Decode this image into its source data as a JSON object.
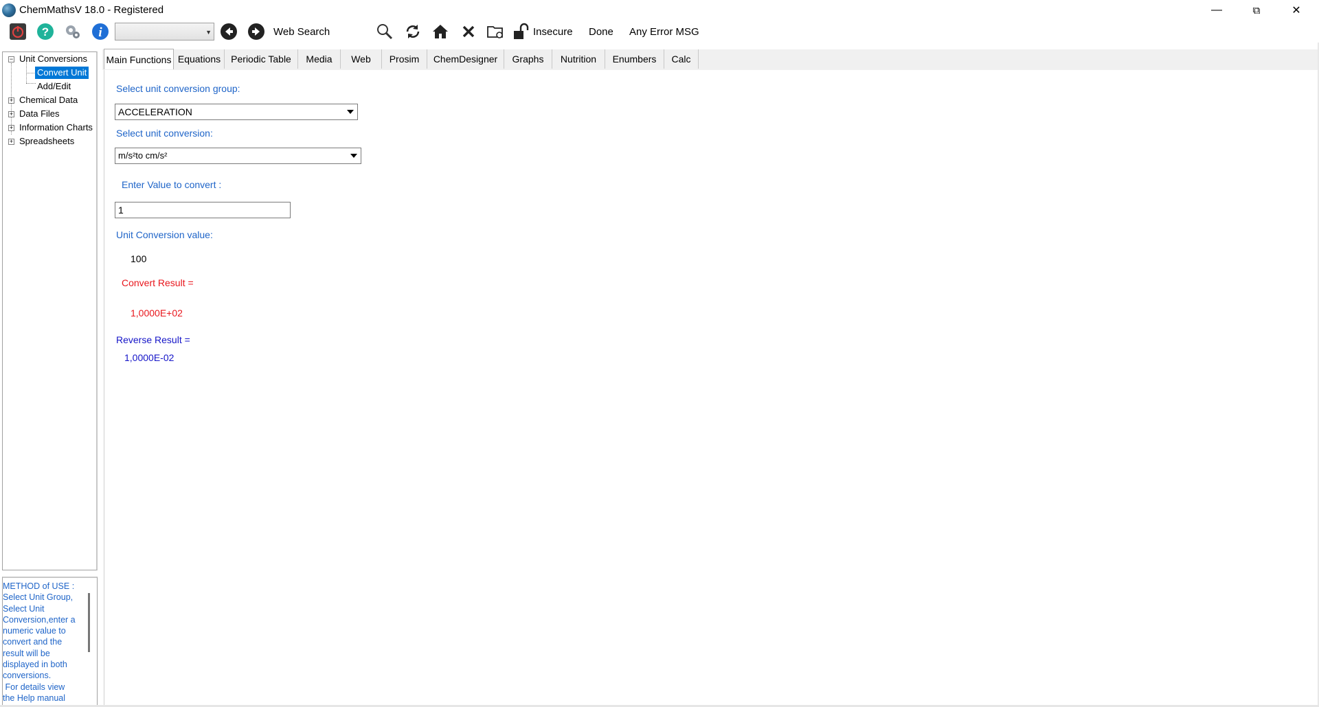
{
  "window": {
    "title": "ChemMathsV 18.0 - Registered",
    "minimize_glyph": "—",
    "maximize_glyph": "⧉",
    "close_glyph": "✕"
  },
  "toolbar": {
    "web_search_label": "Web Search",
    "insecure_label": "Insecure",
    "done_label": "Done",
    "error_label": "Any Error MSG",
    "combo_value": "",
    "icons": [
      "power-icon",
      "help-icon",
      "tools-icon",
      "info-icon",
      "back-arrow-icon",
      "forward-arrow-icon",
      "magnifier-icon",
      "refresh-icon",
      "home-icon",
      "stop-icon",
      "folder-icon",
      "unlock-icon"
    ]
  },
  "tree": {
    "unit_conversions": "Unit Conversions",
    "convert_unit": "Convert Unit",
    "add_edit": "Add/Edit",
    "chemical_data": "Chemical Data",
    "data_files": "Data Files",
    "information_charts": "Information Charts",
    "spreadsheets": "Spreadsheets",
    "expanded_glyph": "−",
    "collapsed_glyph": "+"
  },
  "help_text": "METHOD of USE :\nSelect Unit Group,\nSelect Unit\nConversion,enter a\nnumeric value to\nconvert and the\nresult will be\ndisplayed in both\nconversions.\n For details view\nthe Help manual",
  "tabs": [
    "Main Functions",
    "Equations",
    "Periodic Table",
    "Media",
    "Web",
    "Prosim",
    "ChemDesigner",
    "Graphs",
    "Nutrition",
    "Enumbers",
    "Calc"
  ],
  "main": {
    "group_label": "Select unit conversion group:",
    "group_value": "ACCELERATION",
    "conversion_label": "Select unit conversion:",
    "conversion_value": "m/s²to cm/s²",
    "enter_label": "Enter Value to convert :",
    "enter_value": "1",
    "conv_value_label": "Unit Conversion value:",
    "conv_value": "100",
    "convert_result_label": "Convert Result =",
    "convert_result": "1,0000E+02",
    "reverse_result_label": "Reverse Result =",
    "reverse_result": "1,0000E-02"
  },
  "colors": {
    "label_blue": "#1e64c8",
    "result_red": "#e8161c",
    "reverse_blue": "#1414c8",
    "selection": "#0078d7"
  }
}
